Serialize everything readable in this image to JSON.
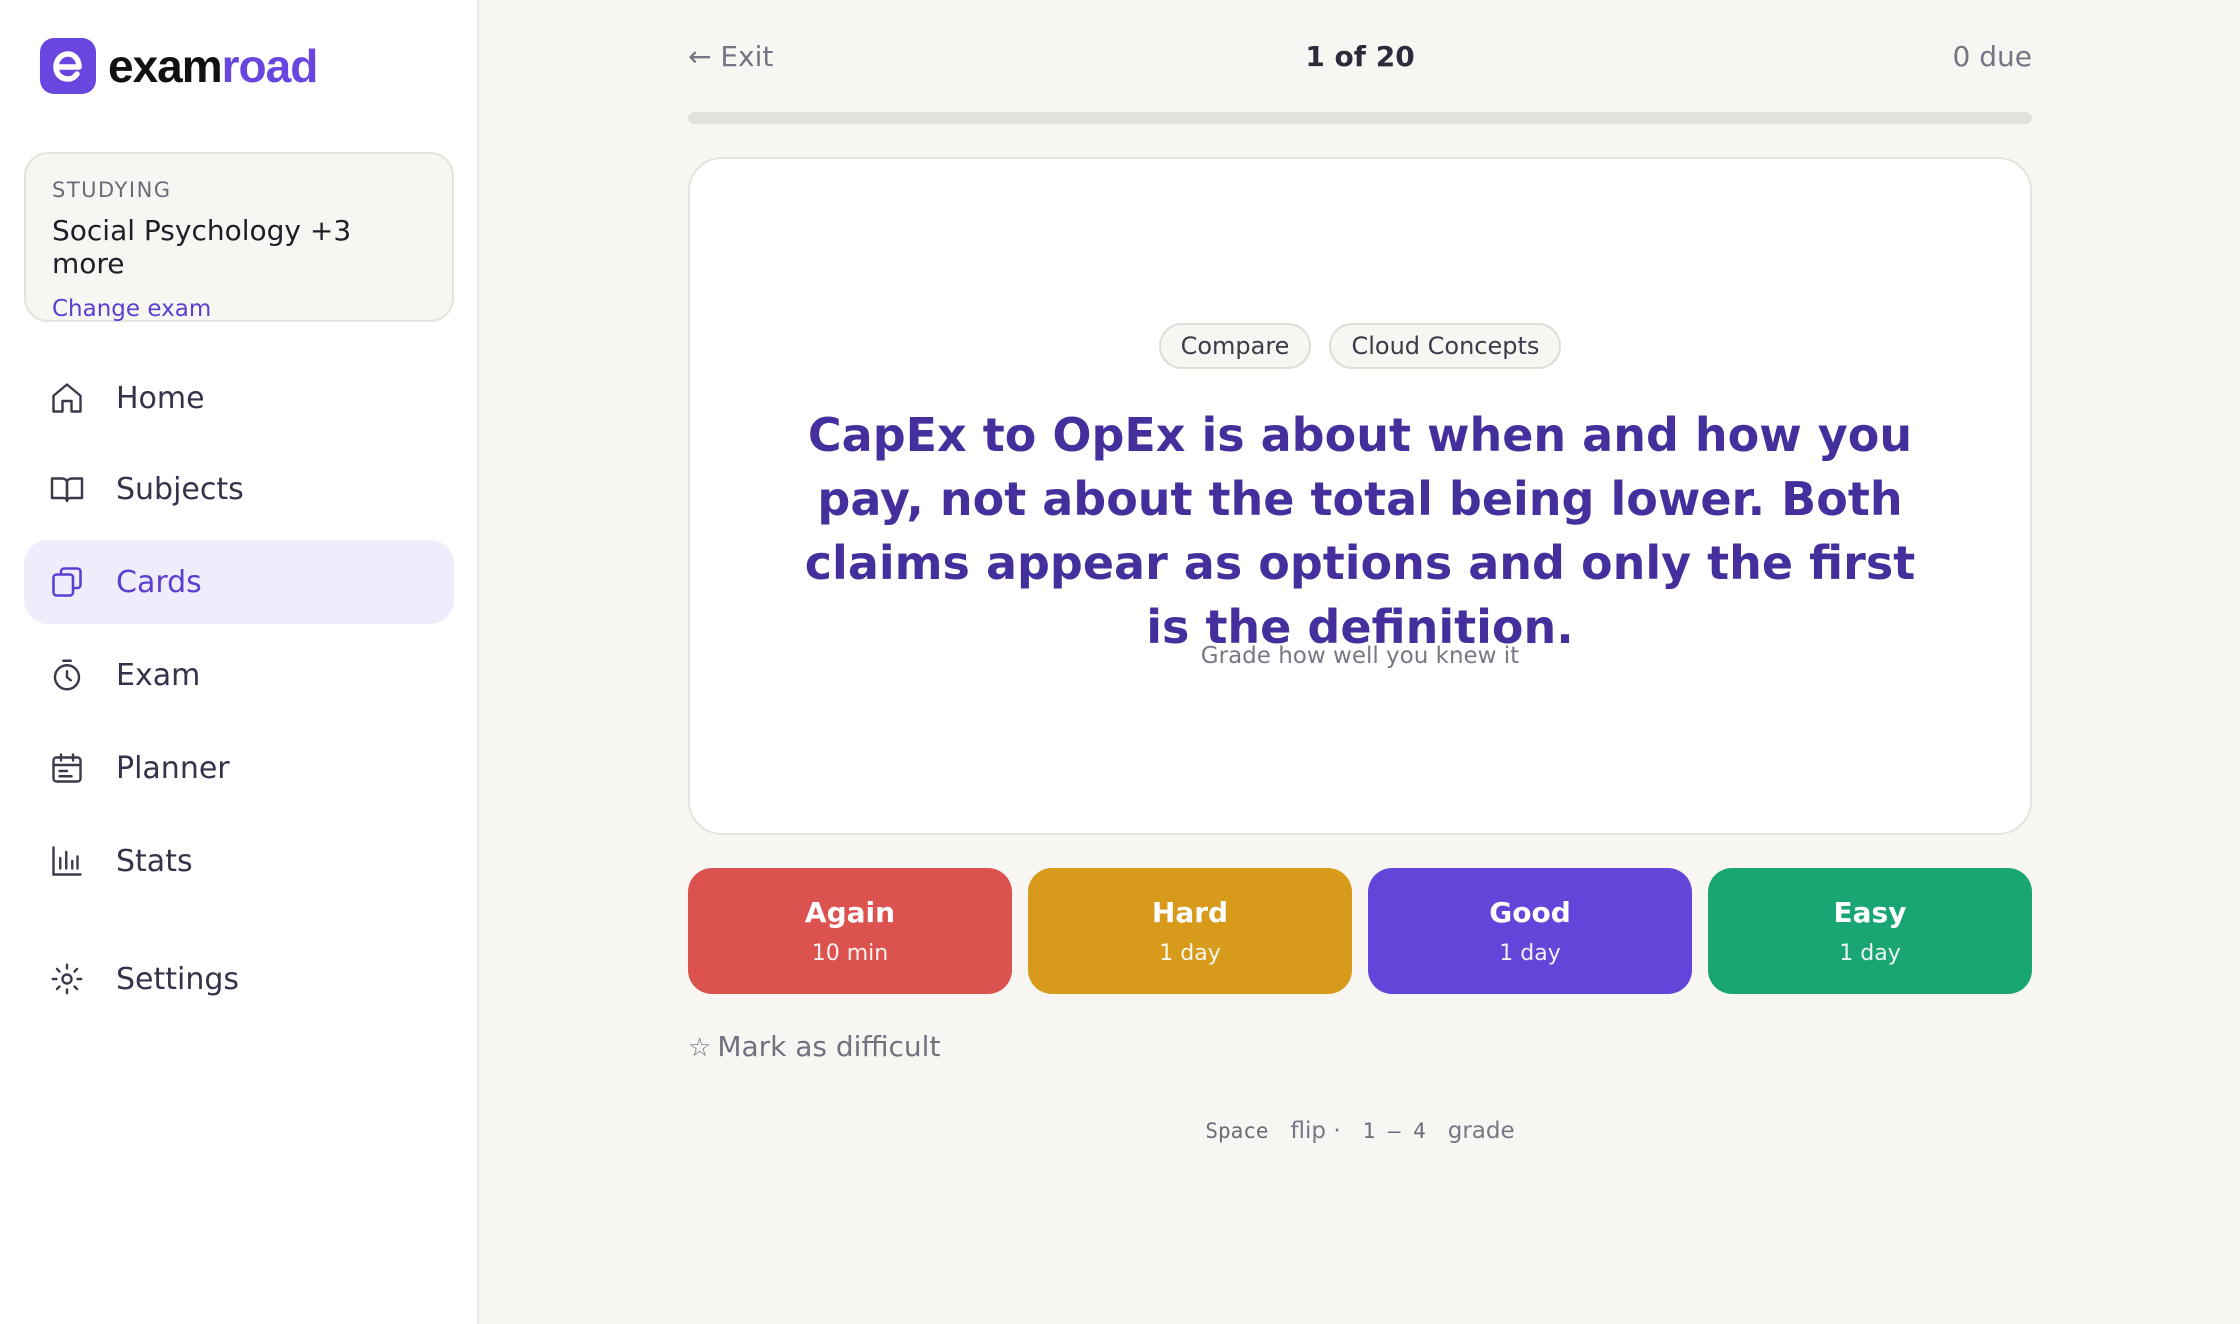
{
  "brand": {
    "name_part1": "exam",
    "name_part2": "road",
    "accent": "#6a46e0"
  },
  "studying": {
    "label": "STUDYING",
    "subject": "Social Psychology +3 more",
    "change_label": "Change exam"
  },
  "nav": {
    "home": "Home",
    "subjects": "Subjects",
    "cards": "Cards",
    "exam": "Exam",
    "planner": "Planner",
    "stats": "Stats",
    "settings": "Settings",
    "active": "Cards"
  },
  "session": {
    "exit_label": "← Exit",
    "counter": "1 of 20",
    "due": "0 due",
    "progress_fraction": 0
  },
  "card": {
    "tags": [
      "Compare",
      "Cloud Concepts"
    ],
    "text": "CapEx to OpEx is about when and how you pay, not about the total being lower. Both claims appear as options and only the first is the definition.",
    "hint": "Grade how well you knew it"
  },
  "grades": [
    {
      "label": "Again",
      "interval": "10 min",
      "color": "#dc524f"
    },
    {
      "label": "Hard",
      "interval": "1 day",
      "color": "#d89a1a"
    },
    {
      "label": "Good",
      "interval": "1 day",
      "color": "#6445d9"
    },
    {
      "label": "Easy",
      "interval": "1 day",
      "color": "#1aa673"
    }
  ],
  "mark_difficult": {
    "star": "☆",
    "label": "Mark as difficult"
  },
  "shortcuts": {
    "key1": "Space",
    "action1": "flip",
    "sep": "·",
    "key2": "1 – 4",
    "action2": "grade"
  }
}
